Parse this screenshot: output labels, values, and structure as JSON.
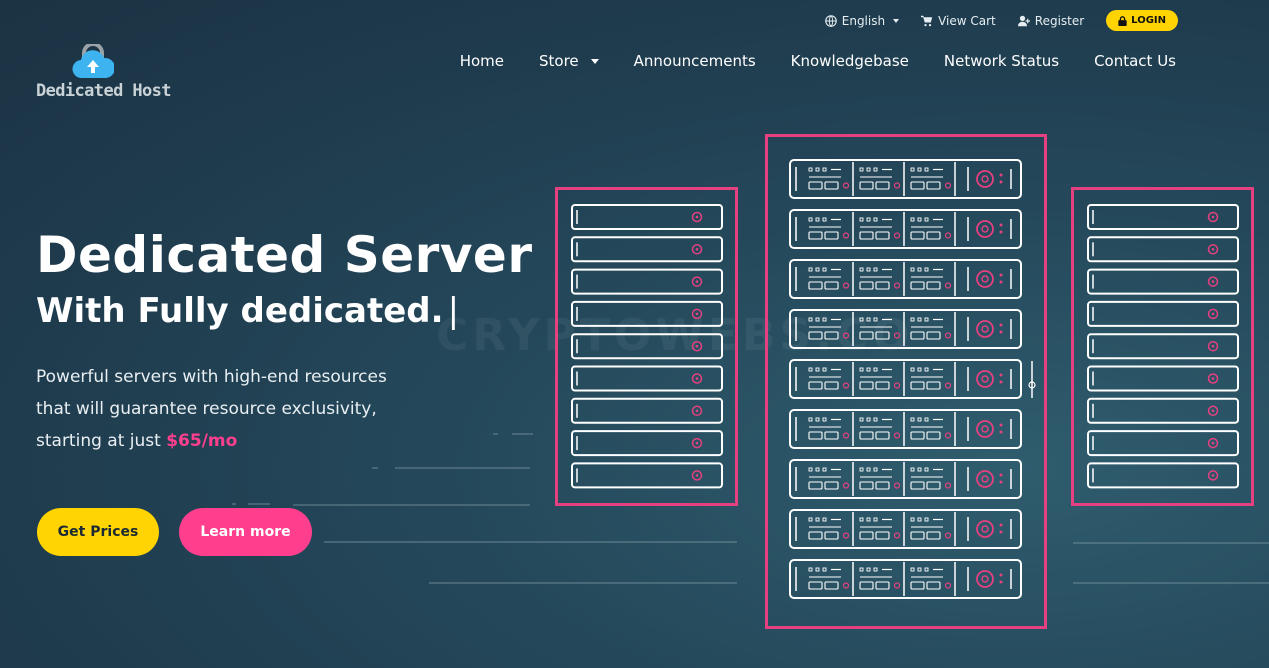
{
  "topbar": {
    "language": "English",
    "cart": "View Cart",
    "register": "Register",
    "login": "LOGIN"
  },
  "logo": {
    "text": "Dedicated Host"
  },
  "nav": {
    "items": [
      {
        "label": "Home"
      },
      {
        "label": "Store"
      },
      {
        "label": "Announcements"
      },
      {
        "label": "Knowledgebase"
      },
      {
        "label": "Network Status"
      },
      {
        "label": "Contact Us"
      }
    ]
  },
  "hero": {
    "title": "Dedicated Server",
    "subtitle": "With Fully dedicated.",
    "cursor": "|",
    "desc_line1": "Powerful servers with high-end resources",
    "desc_line2": "that will guarantee resource exclusivity,",
    "desc_line3": "starting at just ",
    "price": "$65/mo"
  },
  "buttons": {
    "get_prices": "Get Prices",
    "learn_more": "Learn more"
  },
  "watermark": "CRYPTOWEBS.CO",
  "colors": {
    "accent_yellow": "#ffd400",
    "accent_pink": "#ff3f8e",
    "rack_outline": "#e5407f"
  }
}
